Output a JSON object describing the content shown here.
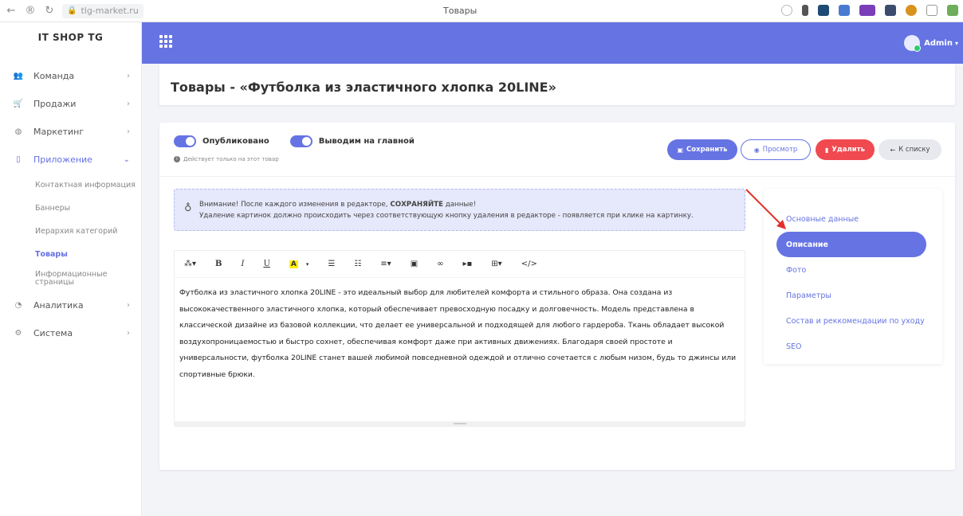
{
  "browser": {
    "url": "tlg-market.ru",
    "tab_title": "Товары"
  },
  "sidebar": {
    "brand": "IT SHOP TG",
    "items": [
      {
        "label": "Команда",
        "icon": "team-icon"
      },
      {
        "label": "Продажи",
        "icon": "cart-icon"
      },
      {
        "label": "Маркетинг",
        "icon": "marketing-icon"
      },
      {
        "label": "Приложение",
        "icon": "mobile-icon"
      },
      {
        "label": "Аналитика",
        "icon": "chart-icon"
      },
      {
        "label": "Система",
        "icon": "cogs-icon"
      }
    ],
    "subitems": [
      {
        "label": "Контактная информация"
      },
      {
        "label": "Баннеры"
      },
      {
        "label": "Иерархия категорий"
      },
      {
        "label": "Товары"
      },
      {
        "label": "Информационные страницы"
      }
    ]
  },
  "header": {
    "user": "Admin"
  },
  "page": {
    "title": "Товары - «Футболка из эластичного хлопка 20LINE»"
  },
  "toggles": {
    "published": "Опубликовано",
    "on_main": "Выводим на главной",
    "hint": "Действует только на этот товар"
  },
  "actions": {
    "save": "Сохранить",
    "preview": "Просмотр",
    "delete": "Удалить",
    "back": "К списку"
  },
  "alert": {
    "line1_prefix": "Внимание! После каждого изменения в редакторе, ",
    "line1_bold": "СОХРАНЯЙТЕ",
    "line1_suffix": " данные!",
    "line2": "Удаление картинок должно происходить через соответствующую кнопку удаления в редакторе - появляется при клике на картинку."
  },
  "editor": {
    "content": "Футболка из эластичного хлопка 20LINE - это идеальный выбор для любителей комфорта и стильного образа. Она создана из высококачественного эластичного хлопка, который обеспечивает превосходную посадку и долговечность. Модель представлена в классической дизайне из базовой коллекции, что делает ее универсальной и подходящей для любого гардероба. Ткань обладает высокой воздухопроницаемостью и быстро сохнет, обеспечивая комфорт даже при активных движениях. Благодаря своей простоте и универсальности, футболка 20LINE станет вашей любимой повседневной одеждой и отлично сочетается с любым низом, будь то джинсы или спортивные брюки.",
    "tools": [
      "magic",
      "B",
      "I",
      "U",
      "A",
      "ul",
      "ol",
      "align",
      "image",
      "link",
      "video",
      "table",
      "code"
    ]
  },
  "sections": [
    {
      "label": "Основные данные"
    },
    {
      "label": "Описание"
    },
    {
      "label": "Фото"
    },
    {
      "label": "Параметры"
    },
    {
      "label": "Состав и реккомендации по уходу"
    },
    {
      "label": "SEO"
    }
  ],
  "colors": {
    "accent": "#6673e3",
    "danger": "#f0494f",
    "annotation": "#e0322a"
  }
}
